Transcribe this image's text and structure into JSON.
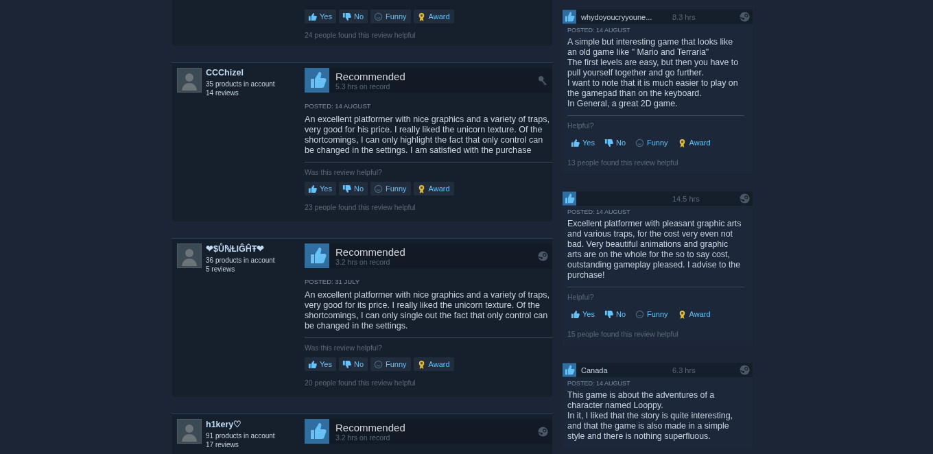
{
  "top_review_tail": {
    "buttons": [
      {
        "label": "Yes",
        "kind": "yes"
      },
      {
        "label": "No",
        "kind": "no"
      },
      {
        "label": "Funny",
        "kind": "funny"
      },
      {
        "label": "Award",
        "kind": "award"
      }
    ],
    "helpful_count": "24 people found this review helpful"
  },
  "reviews": [
    {
      "author": "CCChizel",
      "products": "35 products in account",
      "review_count": "14 reviews",
      "verdict": "Recommended",
      "hours": "5.3 hrs on record",
      "kind": "key",
      "posted": "POSTED: 14 AUGUST",
      "text": "An excellent platformer with nice graphics and a variety of traps, very good for his price. I really liked the unicorn texture. Of the shortcomings, I can only highlight the fact that only control can be changed in the settings. I am satisfied with the purchase",
      "helpful_prompt": "Was this review helpful?",
      "buttons": [
        {
          "label": "Yes",
          "kind": "yes"
        },
        {
          "label": "No",
          "kind": "no"
        },
        {
          "label": "Funny",
          "kind": "funny"
        },
        {
          "label": "Award",
          "kind": "award"
        }
      ],
      "helpful_count": "23 people found this review helpful"
    },
    {
      "author": "❤$ŮℕⱢIĜĤŦ❤",
      "products": "36 products in account",
      "review_count": "5 reviews",
      "verdict": "Recommended",
      "hours": "3.2 hrs on record",
      "kind": "logo",
      "posted": "POSTED: 31 JULY",
      "text": "An excellent platformer with nice graphics and a variety of traps, very good for its price. I really liked the unicorn texture. Of the shortcomings, I can only single out the fact that only control can be changed in the settings.",
      "helpful_prompt": "Was this review helpful?",
      "buttons": [
        {
          "label": "Yes",
          "kind": "yes"
        },
        {
          "label": "No",
          "kind": "no"
        },
        {
          "label": "Funny",
          "kind": "funny"
        },
        {
          "label": "Award",
          "kind": "award"
        }
      ],
      "helpful_count": "20 people found this review helpful"
    },
    {
      "author": "h1kery♡",
      "products": "91 products in account",
      "review_count": "17 reviews",
      "verdict": "Recommended",
      "hours": "3.2 hrs on record",
      "kind": "logo"
    }
  ],
  "side_reviews": [
    {
      "author": "whydoyoucryyoune...",
      "hours": "8.3 hrs",
      "posted": "POSTED: 14 AUGUST",
      "text": "A simple but interesting game that looks like an old game like \" Mario and Terraria\"\nThe first levels are easy, but then you have to pull yourself together and go further.\nI want to note that it is much easier to play on the gamepad than on the keyboard.\nIn General, a great 2D game.",
      "helpful_prompt": "Helpful?",
      "buttons": [
        {
          "label": "Yes",
          "kind": "yes"
        },
        {
          "label": "No",
          "kind": "no"
        },
        {
          "label": "Funny",
          "kind": "funny"
        },
        {
          "label": "Award",
          "kind": "award"
        }
      ],
      "helpful_count": "13 people found this review helpful"
    },
    {
      "hours": "14.5 hrs",
      "posted": "POSTED: 14 AUGUST",
      "text": "Excellent platformer with pleasant graphic arts and various traps, for the cost very even not bad. Very beautiful animations and graphic arts are on the whole for the so to say cost, outstanding gameplay pleased. I advise to the purchase!",
      "helpful_prompt": "Helpful?",
      "buttons": [
        {
          "label": "Yes",
          "kind": "yes"
        },
        {
          "label": "No",
          "kind": "no"
        },
        {
          "label": "Funny",
          "kind": "funny"
        },
        {
          "label": "Award",
          "kind": "award"
        }
      ],
      "helpful_count": "15 people found this review helpful"
    },
    {
      "author": "Canada",
      "hours": "6.3 hrs",
      "posted": "POSTED: 14 AUGUST",
      "text": "This game is about the adventures of a character named Looppy.\nIn it, I liked that the story is quite interesting, and that the game is also made in a simple style and there is nothing superfluous."
    }
  ]
}
